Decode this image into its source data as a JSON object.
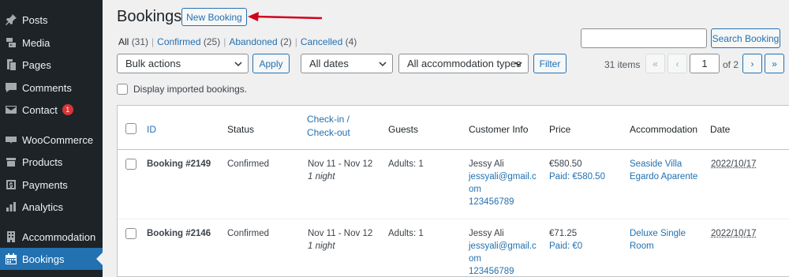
{
  "sidebar": {
    "items": [
      {
        "label": "Posts",
        "icon": "pin-icon"
      },
      {
        "label": "Media",
        "icon": "media-icon"
      },
      {
        "label": "Pages",
        "icon": "pages-icon"
      },
      {
        "label": "Comments",
        "icon": "comments-icon"
      },
      {
        "label": "Contact",
        "icon": "mail-icon",
        "badge": "1"
      },
      {
        "label": "WooCommerce",
        "icon": "woocommerce-icon"
      },
      {
        "label": "Products",
        "icon": "products-icon"
      },
      {
        "label": "Payments",
        "icon": "payments-icon"
      },
      {
        "label": "Analytics",
        "icon": "analytics-icon"
      },
      {
        "label": "Accommodation",
        "icon": "building-icon"
      },
      {
        "label": "Bookings",
        "icon": "calendar-icon",
        "active": true
      }
    ]
  },
  "header": {
    "title": "Bookings",
    "new_booking_label": "New Booking"
  },
  "filters_links": {
    "all": "All",
    "all_count": "(31)",
    "confirmed": "Confirmed",
    "confirmed_count": "(25)",
    "abandoned": "Abandoned",
    "abandoned_count": "(2)",
    "cancelled": "Cancelled",
    "cancelled_count": "(4)",
    "separator": "|"
  },
  "search": {
    "value": "",
    "button_label": "Search Booking"
  },
  "toolbar": {
    "bulk_actions": "Bulk actions",
    "apply": "Apply",
    "dates": "All dates",
    "accommodation_types": "All accommodation types",
    "filter": "Filter"
  },
  "pagination": {
    "items": "31 items",
    "first": "«",
    "prev": "‹",
    "current_page": "1",
    "of": "of 2",
    "next": "›",
    "last": "»"
  },
  "display_imported_label": "Display imported bookings.",
  "table": {
    "columns": {
      "id": "ID",
      "status": "Status",
      "checkin_line1": "Check-in /",
      "checkin_line2": "Check-out",
      "guests": "Guests",
      "customer": "Customer Info",
      "price": "Price",
      "accommodation": "Accommodation",
      "date": "Date"
    },
    "rows": [
      {
        "id": "Booking #2149",
        "status": "Confirmed",
        "dates": "Nov 11 - Nov 12",
        "nights": "1 night",
        "guests": "Adults: 1",
        "customer_name": "Jessy Ali",
        "email_line1": "jessyali@gmail.c",
        "email_line2": "om",
        "phone": "123456789",
        "price": "€580.50",
        "paid": "Paid: €580.50",
        "accommodation_line1": "Seaside Villa",
        "accommodation_line2": "Egardo Aparente",
        "date": "2022/10/17"
      },
      {
        "id": "Booking #2146",
        "status": "Confirmed",
        "dates": "Nov 11 - Nov 12",
        "nights": "1 night",
        "guests": "Adults: 1",
        "customer_name": "Jessy Ali",
        "email_line1": "jessyali@gmail.c",
        "email_line2": "om",
        "phone": "123456789",
        "price": "€71.25",
        "paid": "Paid: €0",
        "accommodation_line1": "Deluxe Single",
        "accommodation_line2": "Room",
        "date": "2022/10/17"
      }
    ]
  },
  "colors": {
    "sidebar_bg": "#1d2327",
    "accent": "#2271b1",
    "badge": "#d63638",
    "arrow": "#d0021b"
  }
}
